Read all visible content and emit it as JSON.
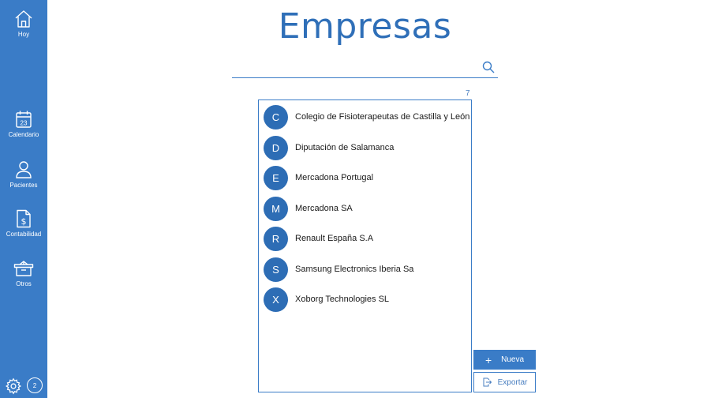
{
  "sidebar": {
    "items": [
      {
        "label": "Hoy",
        "icon": "home-icon"
      },
      {
        "label": "Calendario",
        "icon": "calendar-icon",
        "icon_text": "23"
      },
      {
        "label": "Pacientes",
        "icon": "person-icon"
      },
      {
        "label": "Contabilidad",
        "icon": "invoice-dollar-icon"
      },
      {
        "label": "Otros",
        "icon": "box-icon"
      }
    ],
    "settings_icon": "gear-icon",
    "badge": "2"
  },
  "page": {
    "title": "Empresas"
  },
  "search": {
    "placeholder": "",
    "value": "",
    "icon": "search-icon"
  },
  "list": {
    "count": "7",
    "items": [
      {
        "initial": "C",
        "name": "Colegio de Fisioterapeutas de Castilla y León"
      },
      {
        "initial": "D",
        "name": "Diputación de Salamanca"
      },
      {
        "initial": "E",
        "name": "Mercadona Portugal"
      },
      {
        "initial": "M",
        "name": "Mercadona SA"
      },
      {
        "initial": "R",
        "name": "Renault España S.A"
      },
      {
        "initial": "S",
        "name": "Samsung Electronics Iberia Sa"
      },
      {
        "initial": "X",
        "name": "Xoborg Technologies SL"
      }
    ]
  },
  "actions": {
    "new_label": "Nueva",
    "new_icon": "plus-icon",
    "export_label": "Exportar",
    "export_icon": "export-icon"
  },
  "colors": {
    "accent": "#3a7cc7",
    "avatar": "#2d6db5",
    "title": "#2f6fb8"
  }
}
